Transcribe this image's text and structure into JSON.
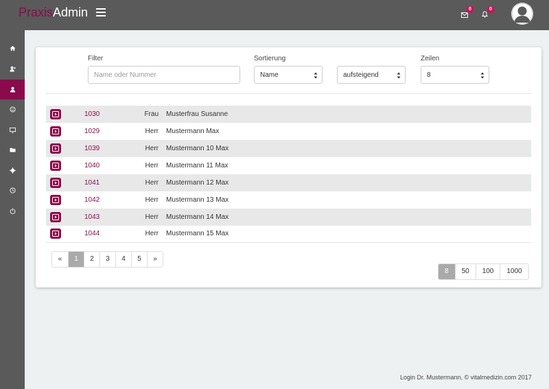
{
  "header": {
    "brand_part1": "Praxis",
    "brand_part2": "Admin",
    "mail_count": "0",
    "notification_count": "0"
  },
  "sidebar": {
    "items": [
      {
        "icon": "home-icon"
      },
      {
        "icon": "user-add-icon"
      },
      {
        "icon": "user-icon",
        "active": true
      },
      {
        "icon": "smiley-icon"
      },
      {
        "icon": "monitor-icon"
      },
      {
        "icon": "folder-icon"
      },
      {
        "icon": "gear-icon"
      },
      {
        "icon": "clock-icon"
      },
      {
        "icon": "logout-icon"
      }
    ]
  },
  "filters": {
    "filter_label": "Filter",
    "filter_placeholder": "Name oder Nummer",
    "sort_label": "Sortierung",
    "sort_field": "Name",
    "sort_order": "aufsteigend",
    "rows_label": "Zeilen",
    "rows_value": "8"
  },
  "patients": [
    {
      "number": "1030",
      "salutation": "Frau",
      "name": "Musterfrau Susanne"
    },
    {
      "number": "1029",
      "salutation": "Herr",
      "name": "Mustermann Max"
    },
    {
      "number": "1039",
      "salutation": "Herr",
      "name": "Mustermann 10 Max"
    },
    {
      "number": "1040",
      "salutation": "Herr",
      "name": "Mustermann 11 Max"
    },
    {
      "number": "1041",
      "salutation": "Herr",
      "name": "Mustermann 12 Max"
    },
    {
      "number": "1042",
      "salutation": "Herr",
      "name": "Mustermann 13 Max"
    },
    {
      "number": "1043",
      "salutation": "Herr",
      "name": "Mustermann 14 Max"
    },
    {
      "number": "1044",
      "salutation": "Herr",
      "name": "Mustermann 15 Max"
    }
  ],
  "pagination": {
    "prev": "«",
    "pages": [
      "1",
      "2",
      "3",
      "4",
      "5"
    ],
    "active_page": "1",
    "next": "»"
  },
  "page_sizes": {
    "options": [
      "8",
      "50",
      "100",
      "1000"
    ],
    "active": "8"
  },
  "footer": {
    "text": "Login Dr. Mustermann, © vitalmedizin.com 2017"
  },
  "colors": {
    "accent": "#8b0a4c",
    "topbar": "#5a5a5a",
    "badge": "#c2185b"
  }
}
